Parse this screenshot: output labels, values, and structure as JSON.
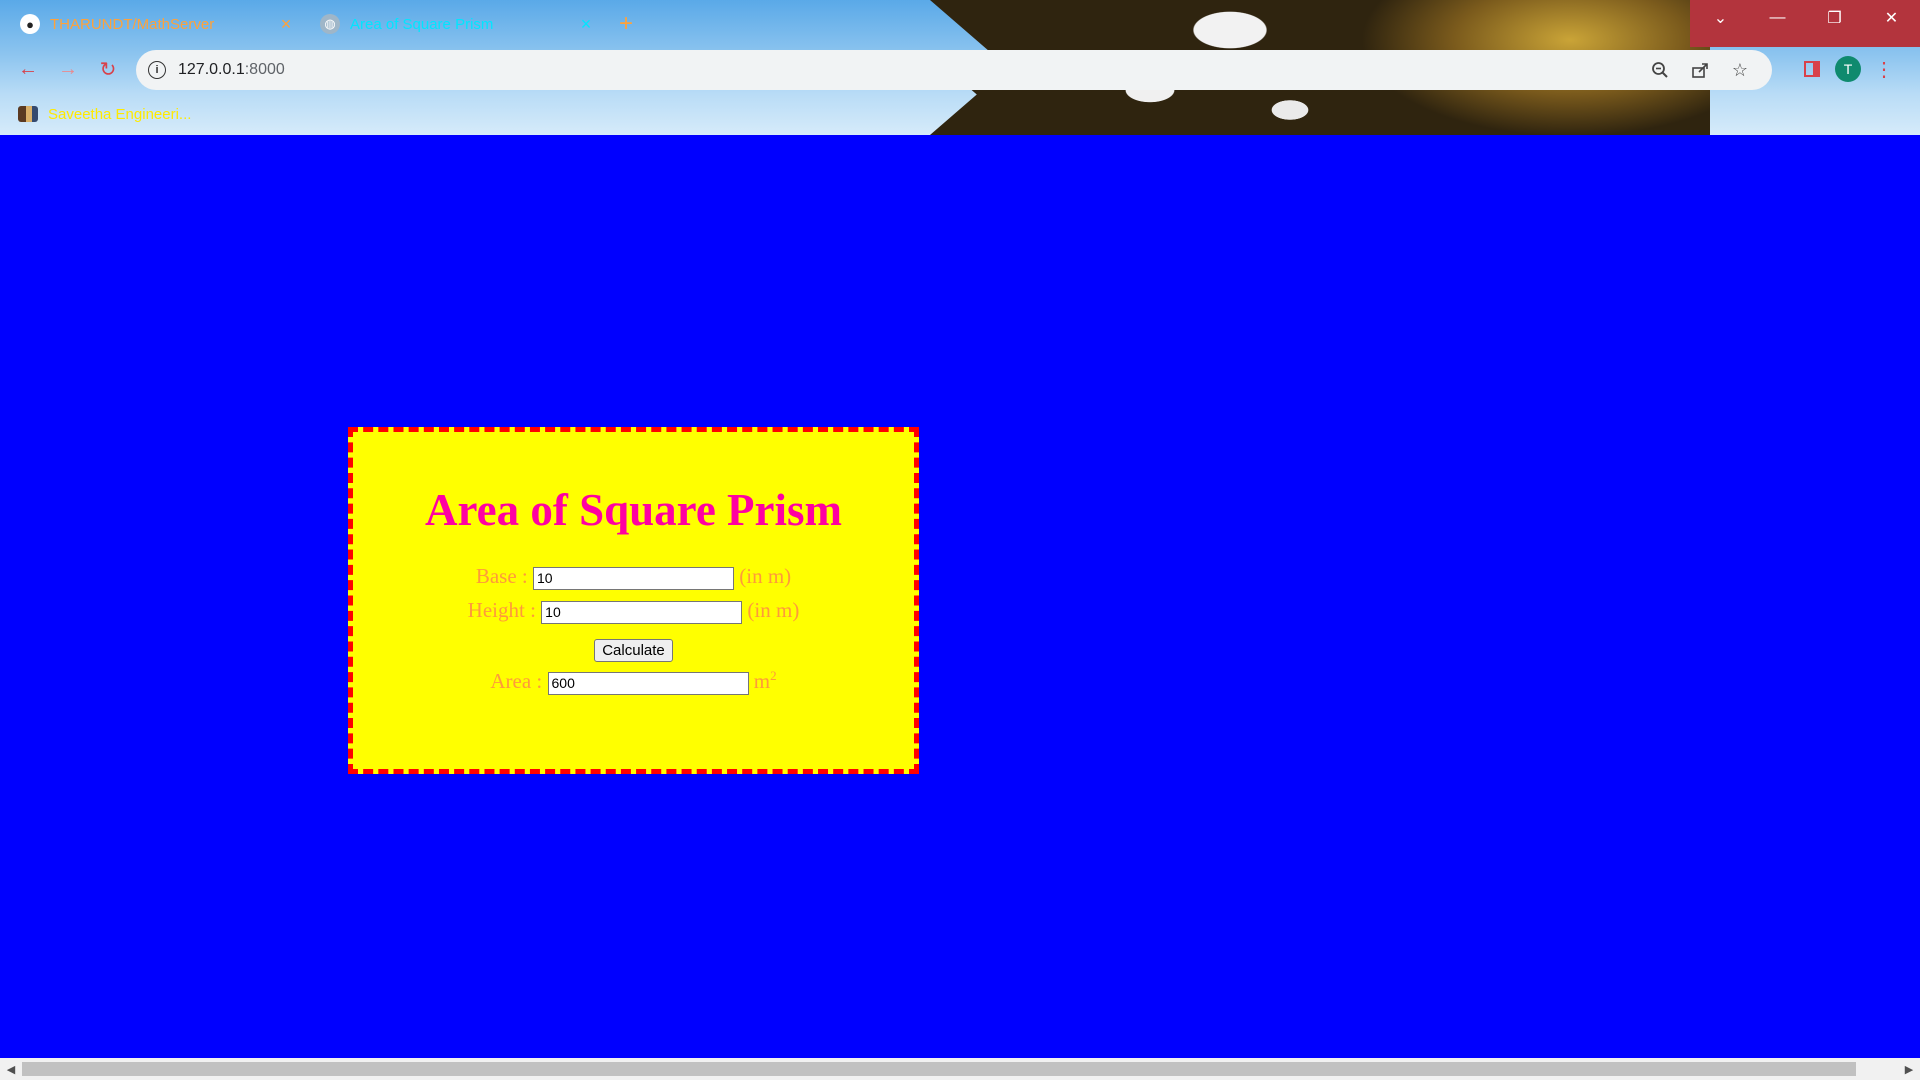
{
  "browser": {
    "tabs": [
      {
        "title": "THARUNDT/MathServer",
        "favicon": "github-icon",
        "active": false
      },
      {
        "title": "Area of Square Prism",
        "favicon": "globe-icon",
        "active": true
      }
    ],
    "new_tab_symbol": "+",
    "window_controls": {
      "dropdown": "⌄",
      "minimize": "—",
      "restore": "❐",
      "close": "✕"
    },
    "address": {
      "host": "127.0.0.1",
      "port": ":8000"
    },
    "info_icon": "i",
    "avatar_letter": "T",
    "bookmarks": [
      {
        "label": "Saveetha Engineeri..."
      }
    ]
  },
  "page": {
    "heading": "Area of Square Prism",
    "base": {
      "label": "Base :",
      "value": "10",
      "unit": "(in m)"
    },
    "height": {
      "label": "Height :",
      "value": "10",
      "unit": "(in m)"
    },
    "calculate_label": "Calculate",
    "area": {
      "label": "Area :",
      "value": "600",
      "unit": "m",
      "unit_sup": "2"
    }
  },
  "colors": {
    "page_background": "#0000ff",
    "card_background": "#ffff00",
    "card_border": "#ff0000",
    "heading": "#ff00a2",
    "label_text": "#ff9a3a"
  }
}
